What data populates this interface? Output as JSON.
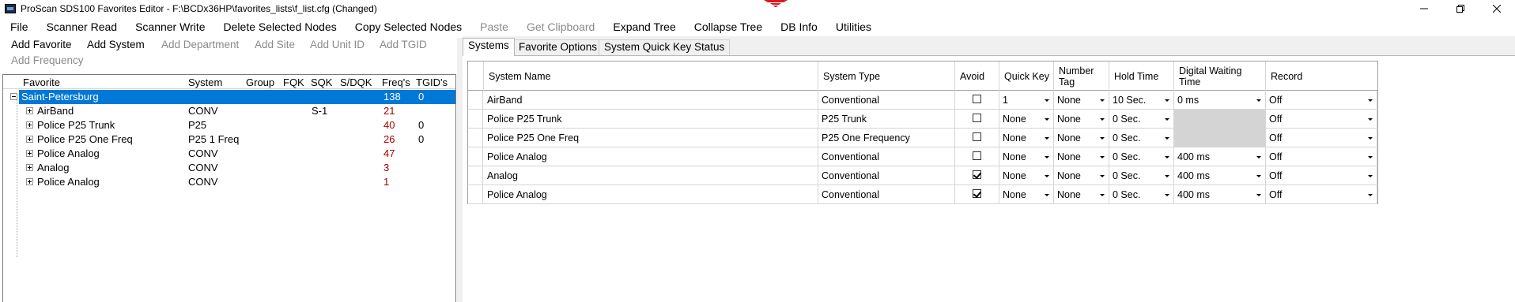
{
  "window": {
    "title": "ProScan SDS100 Favorites Editor - F:\\BCDx36HP\\favorites_lists\\f_list.cfg (Changed)",
    "minimize_icon": "minimize-icon",
    "maximize_icon": "restore-icon",
    "close_icon": "close-icon"
  },
  "menubar": {
    "items": [
      {
        "label": "File",
        "enabled": true
      },
      {
        "label": "Scanner Read",
        "enabled": true
      },
      {
        "label": "Scanner Write",
        "enabled": true
      },
      {
        "label": "Delete Selected Nodes",
        "enabled": true
      },
      {
        "label": "Copy Selected Nodes",
        "enabled": true
      },
      {
        "label": "Paste",
        "enabled": false
      },
      {
        "label": "Get Clipboard",
        "enabled": false
      },
      {
        "label": "Expand Tree",
        "enabled": true
      },
      {
        "label": "Collapse Tree",
        "enabled": true
      },
      {
        "label": "DB Info",
        "enabled": true
      },
      {
        "label": "Utilities",
        "enabled": true
      }
    ]
  },
  "toolbar": {
    "add_favorite": "Add Favorite",
    "add_system": "Add System",
    "add_department": "Add Department",
    "add_site": "Add Site",
    "add_unit_id": "Add Unit ID",
    "add_tgid": "Add TGID",
    "add_frequency": "Add Frequency"
  },
  "tree": {
    "headers": {
      "favorite": "Favorite",
      "system": "System",
      "group": "Group",
      "fqk": "FQK",
      "sqk": "SQK",
      "sdqk": "S/DQK",
      "freqs": "Freq's",
      "tgids": "TGID's"
    },
    "root": {
      "favorite": "Saint-Petersburg",
      "freqs": "138",
      "tgids": "0"
    },
    "children": [
      {
        "favorite": "AirBand",
        "system": "CONV",
        "sqk": "S-1",
        "freqs": "21",
        "tgids": ""
      },
      {
        "favorite": "Police P25 Trunk",
        "system": "P25",
        "sqk": "",
        "freqs": "40",
        "tgids": "0"
      },
      {
        "favorite": "Police P25 One Freq",
        "system": "P25 1 Freq",
        "sqk": "",
        "freqs": "26",
        "tgids": "0"
      },
      {
        "favorite": "Police Analog",
        "system": "CONV",
        "sqk": "",
        "freqs": "47",
        "tgids": ""
      },
      {
        "favorite": "Analog",
        "system": "CONV",
        "sqk": "",
        "freqs": "3",
        "tgids": ""
      },
      {
        "favorite": "Police Analog",
        "system": "CONV",
        "sqk": "",
        "freqs": "1",
        "tgids": ""
      }
    ]
  },
  "tabs": [
    {
      "label": "Systems",
      "active": true
    },
    {
      "label": "Favorite Options",
      "active": false
    },
    {
      "label": "System Quick Key Status",
      "active": false
    }
  ],
  "grid": {
    "columns": {
      "system_name": "System Name",
      "system_type": "System Type",
      "avoid": "Avoid",
      "quick_key": "Quick Key",
      "number_tag": "Number Tag",
      "hold_time": "Hold Time",
      "digital_waiting_time": "Digital Waiting Time",
      "record": "Record"
    },
    "rows": [
      {
        "name": "AirBand",
        "type": "Conventional",
        "avoid": false,
        "quick_key": "1",
        "number_tag": "None",
        "hold_time": "10 Sec.",
        "dwt": "0 ms",
        "dwt_disabled": false,
        "record": "Off"
      },
      {
        "name": "Police P25 Trunk",
        "type": "P25 Trunk",
        "avoid": false,
        "quick_key": "None",
        "number_tag": "None",
        "hold_time": "0 Sec.",
        "dwt": "",
        "dwt_disabled": true,
        "record": "Off"
      },
      {
        "name": "Police P25 One Freq",
        "type": "P25 One Frequency",
        "avoid": false,
        "quick_key": "None",
        "number_tag": "None",
        "hold_time": "0 Sec.",
        "dwt": "",
        "dwt_disabled": true,
        "record": "Off"
      },
      {
        "name": "Police Analog",
        "type": "Conventional",
        "avoid": false,
        "quick_key": "None",
        "number_tag": "None",
        "hold_time": "0 Sec.",
        "dwt": "400 ms",
        "dwt_disabled": false,
        "record": "Off"
      },
      {
        "name": "Analog",
        "type": "Conventional",
        "avoid": true,
        "quick_key": "None",
        "number_tag": "None",
        "hold_time": "0 Sec.",
        "dwt": "400 ms",
        "dwt_disabled": false,
        "record": "Off"
      },
      {
        "name": "Police Analog",
        "type": "Conventional",
        "avoid": true,
        "quick_key": "None",
        "number_tag": "None",
        "hold_time": "0 Sec.",
        "dwt": "400 ms",
        "dwt_disabled": false,
        "record": "Off"
      }
    ]
  },
  "colors": {
    "selection": "#0078d7",
    "freq_text": "#a80000",
    "disabled_text": "#8a8a8a",
    "logo": "#d71920"
  }
}
